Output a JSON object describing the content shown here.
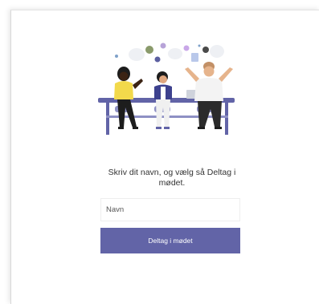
{
  "join": {
    "prompt": "Skriv dit navn, og vælg så Deltag i mødet.",
    "name_placeholder": "Navn",
    "join_button_label": "Deltag i mødet"
  },
  "colors": {
    "accent": "#6264a7",
    "illustration_table": "#6264a7",
    "illustration_skin_dark": "#3b2314",
    "illustration_yellow": "#f2d94b"
  }
}
